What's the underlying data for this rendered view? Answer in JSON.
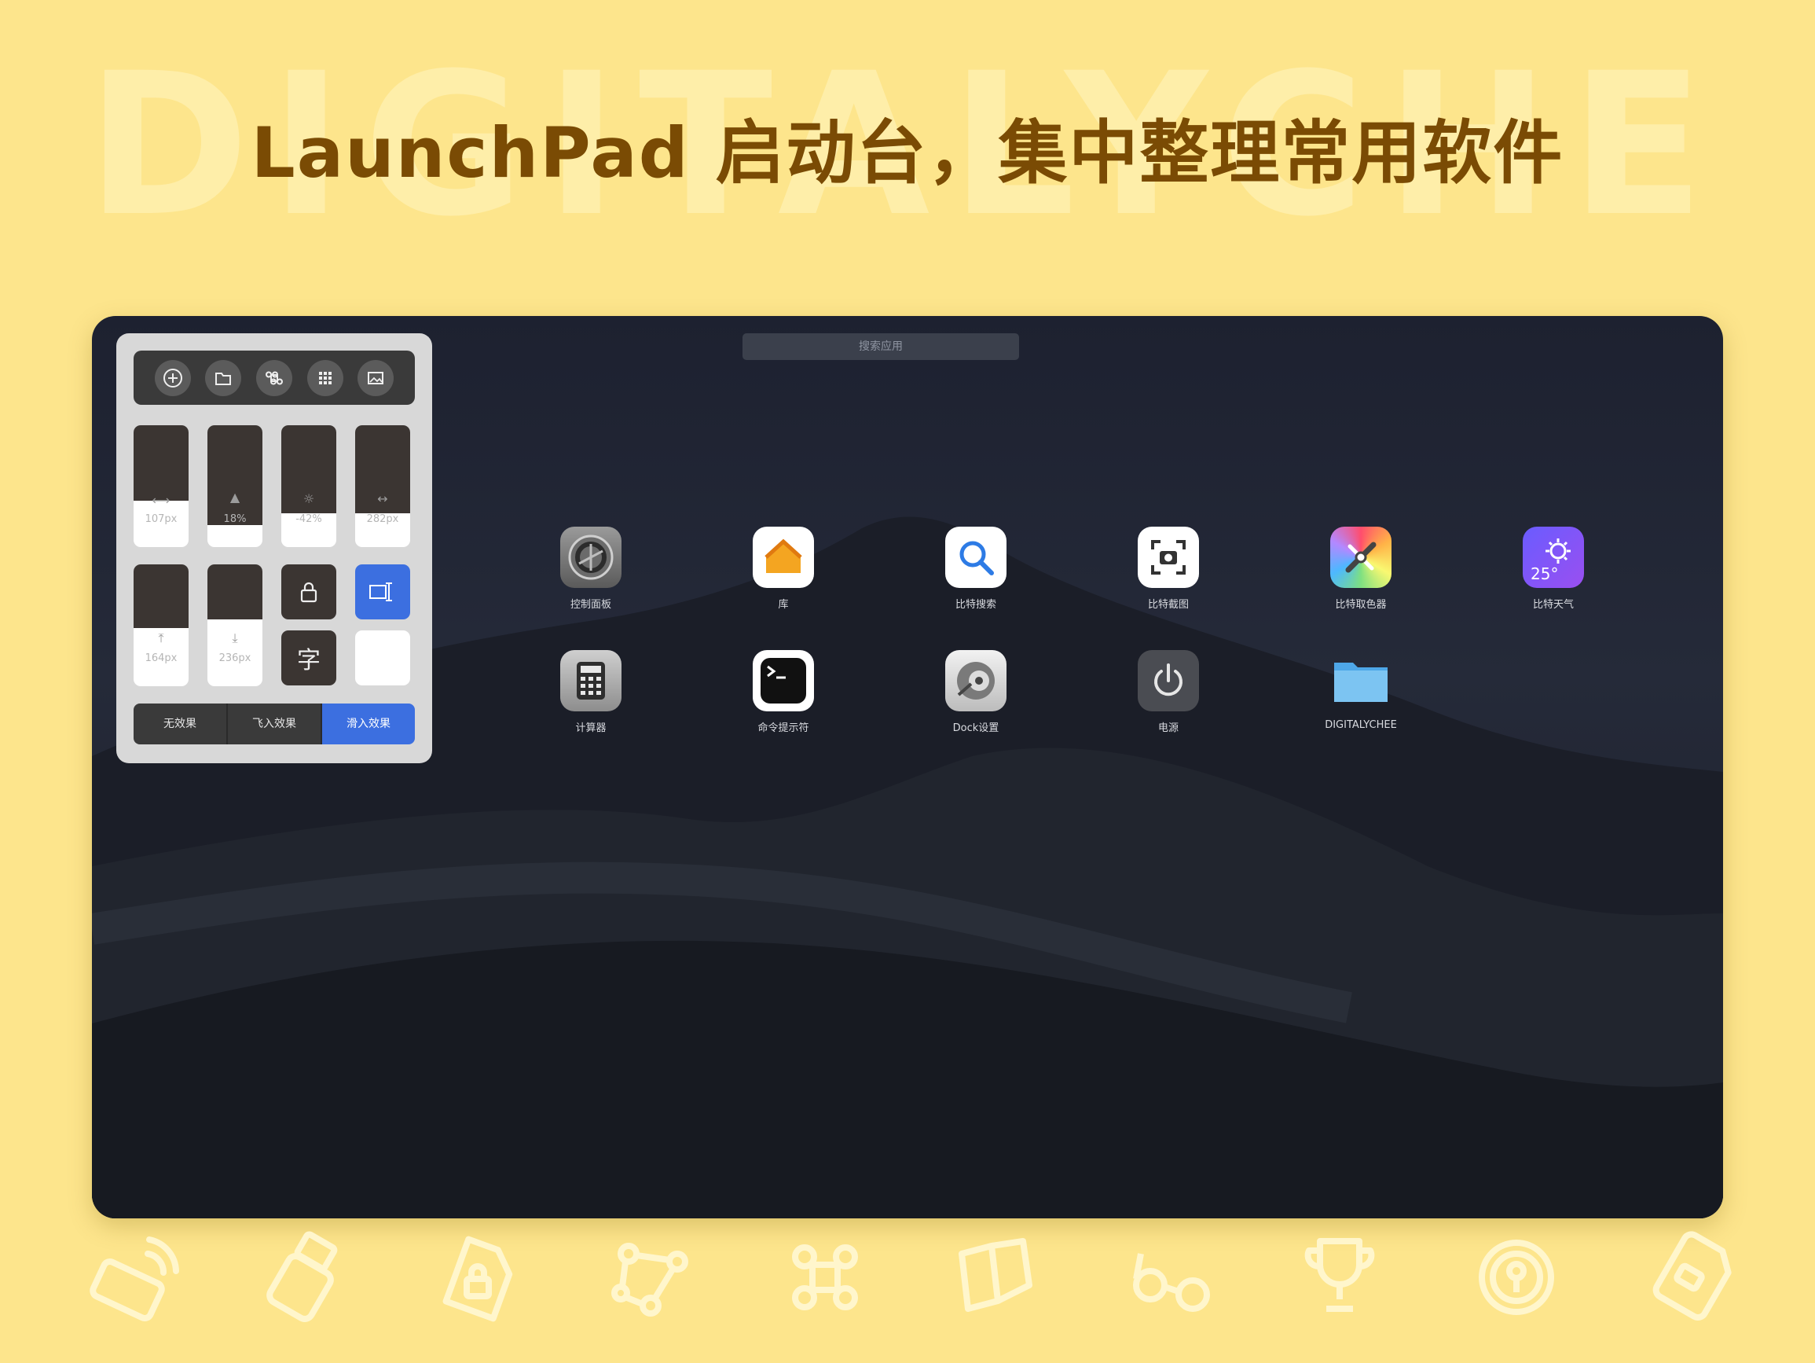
{
  "headline": "LaunchPad 启动台，集中整理常用软件",
  "watermark": "DIGITALYCHEE",
  "search": {
    "placeholder": "搜索应用"
  },
  "panel": {
    "toolbar": [
      "add-icon",
      "folder-icon",
      "command-icon",
      "grid-icon",
      "image-icon"
    ],
    "sliders": [
      {
        "icon": "width-icon",
        "value_label": "107px",
        "fill_fraction": 0.62
      },
      {
        "icon": "triangle-icon",
        "value_label": "18%",
        "fill_fraction": 0.82
      },
      {
        "icon": "brightness-icon",
        "value_label": "-42%",
        "fill_fraction": 0.72
      },
      {
        "icon": "spacing-icon",
        "value_label": "282px",
        "fill_fraction": 0.72
      },
      {
        "icon": "top-margin-icon",
        "value_label": "164px",
        "fill_fraction": 0.52
      },
      {
        "icon": "bottom-margin-icon",
        "value_label": "236px",
        "fill_fraction": 0.45
      }
    ],
    "buttons": {
      "lock": "lock-icon",
      "resize": "resize-icon",
      "font_glyph": "字"
    },
    "effects": [
      "无效果",
      "飞入效果",
      "滑入效果"
    ],
    "active_effect": "滑入效果"
  },
  "apps": [
    {
      "name": "控制面板",
      "icon": "control-panel-icon"
    },
    {
      "name": "库",
      "icon": "home-icon"
    },
    {
      "name": "比特搜索",
      "icon": "search-icon"
    },
    {
      "name": "比特截图",
      "icon": "screenshot-icon"
    },
    {
      "name": "比特取色器",
      "icon": "color-picker-icon"
    },
    {
      "name": "比特天气",
      "icon": "weather-icon",
      "temp": "25°"
    },
    {
      "name": "计算器",
      "icon": "calculator-icon"
    },
    {
      "name": "命令提示符",
      "icon": "terminal-icon"
    },
    {
      "name": "Dock设置",
      "icon": "dock-settings-icon"
    },
    {
      "name": "电源",
      "icon": "power-icon"
    },
    {
      "name": "DIGITALYCHEE",
      "icon": "folder-icon"
    }
  ],
  "bottom_icons": [
    "wifi-card-icon",
    "usb-drive-icon",
    "locked-file-icon",
    "vector-nodes-icon",
    "command-icon",
    "book-icon",
    "glasses-icon",
    "trophy-icon",
    "key-coin-icon",
    "sd-card-icon"
  ],
  "colors": {
    "background": "#fde58c",
    "headline": "#7a4b04",
    "accent": "#3c6fe0"
  }
}
